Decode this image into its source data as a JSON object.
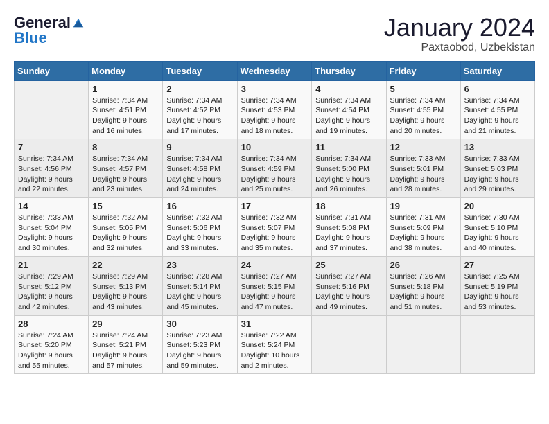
{
  "logo": {
    "general": "General",
    "blue": "Blue"
  },
  "title": "January 2024",
  "location": "Paxtaobod, Uzbekistan",
  "days_header": [
    "Sunday",
    "Monday",
    "Tuesday",
    "Wednesday",
    "Thursday",
    "Friday",
    "Saturday"
  ],
  "weeks": [
    [
      {
        "day": "",
        "info": ""
      },
      {
        "day": "1",
        "info": "Sunrise: 7:34 AM\nSunset: 4:51 PM\nDaylight: 9 hours\nand 16 minutes."
      },
      {
        "day": "2",
        "info": "Sunrise: 7:34 AM\nSunset: 4:52 PM\nDaylight: 9 hours\nand 17 minutes."
      },
      {
        "day": "3",
        "info": "Sunrise: 7:34 AM\nSunset: 4:53 PM\nDaylight: 9 hours\nand 18 minutes."
      },
      {
        "day": "4",
        "info": "Sunrise: 7:34 AM\nSunset: 4:54 PM\nDaylight: 9 hours\nand 19 minutes."
      },
      {
        "day": "5",
        "info": "Sunrise: 7:34 AM\nSunset: 4:55 PM\nDaylight: 9 hours\nand 20 minutes."
      },
      {
        "day": "6",
        "info": "Sunrise: 7:34 AM\nSunset: 4:55 PM\nDaylight: 9 hours\nand 21 minutes."
      }
    ],
    [
      {
        "day": "7",
        "info": "Sunrise: 7:34 AM\nSunset: 4:56 PM\nDaylight: 9 hours\nand 22 minutes."
      },
      {
        "day": "8",
        "info": "Sunrise: 7:34 AM\nSunset: 4:57 PM\nDaylight: 9 hours\nand 23 minutes."
      },
      {
        "day": "9",
        "info": "Sunrise: 7:34 AM\nSunset: 4:58 PM\nDaylight: 9 hours\nand 24 minutes."
      },
      {
        "day": "10",
        "info": "Sunrise: 7:34 AM\nSunset: 4:59 PM\nDaylight: 9 hours\nand 25 minutes."
      },
      {
        "day": "11",
        "info": "Sunrise: 7:34 AM\nSunset: 5:00 PM\nDaylight: 9 hours\nand 26 minutes."
      },
      {
        "day": "12",
        "info": "Sunrise: 7:33 AM\nSunset: 5:01 PM\nDaylight: 9 hours\nand 28 minutes."
      },
      {
        "day": "13",
        "info": "Sunrise: 7:33 AM\nSunset: 5:03 PM\nDaylight: 9 hours\nand 29 minutes."
      }
    ],
    [
      {
        "day": "14",
        "info": "Sunrise: 7:33 AM\nSunset: 5:04 PM\nDaylight: 9 hours\nand 30 minutes."
      },
      {
        "day": "15",
        "info": "Sunrise: 7:32 AM\nSunset: 5:05 PM\nDaylight: 9 hours\nand 32 minutes."
      },
      {
        "day": "16",
        "info": "Sunrise: 7:32 AM\nSunset: 5:06 PM\nDaylight: 9 hours\nand 33 minutes."
      },
      {
        "day": "17",
        "info": "Sunrise: 7:32 AM\nSunset: 5:07 PM\nDaylight: 9 hours\nand 35 minutes."
      },
      {
        "day": "18",
        "info": "Sunrise: 7:31 AM\nSunset: 5:08 PM\nDaylight: 9 hours\nand 37 minutes."
      },
      {
        "day": "19",
        "info": "Sunrise: 7:31 AM\nSunset: 5:09 PM\nDaylight: 9 hours\nand 38 minutes."
      },
      {
        "day": "20",
        "info": "Sunrise: 7:30 AM\nSunset: 5:10 PM\nDaylight: 9 hours\nand 40 minutes."
      }
    ],
    [
      {
        "day": "21",
        "info": "Sunrise: 7:29 AM\nSunset: 5:12 PM\nDaylight: 9 hours\nand 42 minutes."
      },
      {
        "day": "22",
        "info": "Sunrise: 7:29 AM\nSunset: 5:13 PM\nDaylight: 9 hours\nand 43 minutes."
      },
      {
        "day": "23",
        "info": "Sunrise: 7:28 AM\nSunset: 5:14 PM\nDaylight: 9 hours\nand 45 minutes."
      },
      {
        "day": "24",
        "info": "Sunrise: 7:27 AM\nSunset: 5:15 PM\nDaylight: 9 hours\nand 47 minutes."
      },
      {
        "day": "25",
        "info": "Sunrise: 7:27 AM\nSunset: 5:16 PM\nDaylight: 9 hours\nand 49 minutes."
      },
      {
        "day": "26",
        "info": "Sunrise: 7:26 AM\nSunset: 5:18 PM\nDaylight: 9 hours\nand 51 minutes."
      },
      {
        "day": "27",
        "info": "Sunrise: 7:25 AM\nSunset: 5:19 PM\nDaylight: 9 hours\nand 53 minutes."
      }
    ],
    [
      {
        "day": "28",
        "info": "Sunrise: 7:24 AM\nSunset: 5:20 PM\nDaylight: 9 hours\nand 55 minutes."
      },
      {
        "day": "29",
        "info": "Sunrise: 7:24 AM\nSunset: 5:21 PM\nDaylight: 9 hours\nand 57 minutes."
      },
      {
        "day": "30",
        "info": "Sunrise: 7:23 AM\nSunset: 5:23 PM\nDaylight: 9 hours\nand 59 minutes."
      },
      {
        "day": "31",
        "info": "Sunrise: 7:22 AM\nSunset: 5:24 PM\nDaylight: 10 hours\nand 2 minutes."
      },
      {
        "day": "",
        "info": ""
      },
      {
        "day": "",
        "info": ""
      },
      {
        "day": "",
        "info": ""
      }
    ]
  ]
}
